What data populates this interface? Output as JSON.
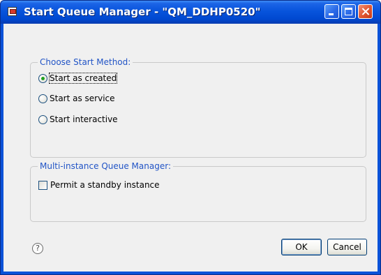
{
  "window": {
    "title": "Start Queue Manager - \"QM_DDHP0520\""
  },
  "titlebar_buttons": [
    "minimize-icon",
    "maximize-icon",
    "close-icon"
  ],
  "start_method": {
    "legend": "Choose Start Method:",
    "options": [
      {
        "label": "Start as created",
        "selected": true
      },
      {
        "label": "Start as service",
        "selected": false
      },
      {
        "label": "Start interactive",
        "selected": false
      }
    ]
  },
  "multi_instance": {
    "legend": "Multi-instance Queue Manager:",
    "checkbox_label": "Permit a standby instance",
    "checked": false
  },
  "footer": {
    "help_glyph": "?",
    "ok_label": "OK",
    "cancel_label": "Cancel"
  },
  "colors": {
    "titlebar": "#0754dc",
    "legend_text": "#2154c6",
    "radio_selected": "#21a121"
  }
}
